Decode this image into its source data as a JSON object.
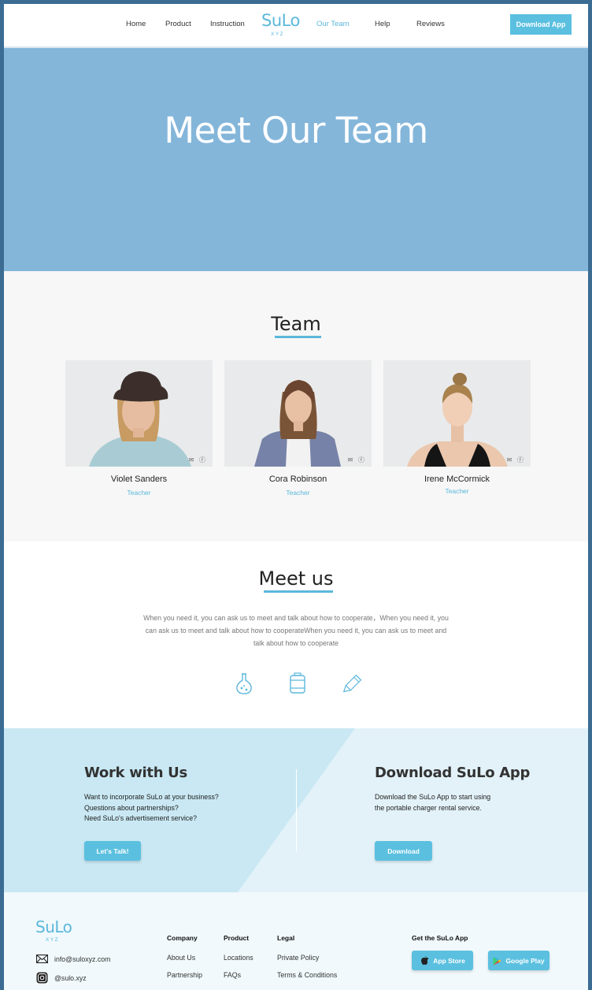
{
  "nav": {
    "links": [
      "Home",
      "Product",
      "Instruction",
      "Our Team",
      "Help",
      "Reviews"
    ],
    "active": "Our Team",
    "logo_main": "SuLo",
    "logo_sub": "XYZ",
    "download_label": "Download App"
  },
  "hero": {
    "title": "Meet Our Team"
  },
  "team": {
    "title": "Team",
    "members": [
      {
        "name": "Violet Sanders",
        "role": "Teacher"
      },
      {
        "name": "Cora Robinson",
        "role": "Teacher"
      },
      {
        "name": "Irene McCormick",
        "role": "Teacher"
      }
    ]
  },
  "meet": {
    "title": "Meet us",
    "text": "When you need it, you can ask us to meet and talk about how to cooperate，When you need it, you can ask us to meet and talk about how to cooperateWhen you need it, you can ask us to meet and talk about how to cooperate",
    "icons": [
      "flask-icon",
      "battery-icon",
      "highlighter-icon"
    ]
  },
  "work": {
    "title": "Work with Us",
    "lines": [
      "Want to incorporate SuLo at your business?",
      "Questions about partnerships?",
      "Need SuLo's advertisement service?"
    ],
    "button": "Let's Talk!"
  },
  "download": {
    "title": "Download SuLo App",
    "lines": [
      "Download the SuLo App to start using",
      "the portable charger rental service."
    ],
    "button": "Download"
  },
  "footer": {
    "logo_main": "SuLo",
    "logo_sub": "XYZ",
    "email": "info@suloxyz.com",
    "instagram": "@sulo.xyz",
    "company": {
      "title": "Company",
      "links": [
        "About Us",
        "Partnership"
      ]
    },
    "product": {
      "title": "Product",
      "links": [
        "Locations",
        "FAQs"
      ]
    },
    "legal": {
      "title": "Legal",
      "links": [
        "Private Policy",
        "Terms & Conditions"
      ]
    },
    "app": {
      "title": "Get the SuLo App",
      "app_store": "App Store",
      "google_play": "Google Play"
    }
  },
  "colors": {
    "accent": "#5bc0e0",
    "hero_bg": "#84b6da",
    "frame": "#3b6c93"
  }
}
